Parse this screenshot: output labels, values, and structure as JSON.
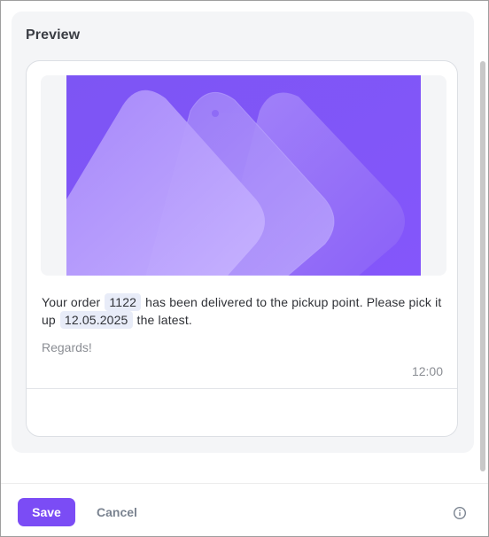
{
  "preview": {
    "title": "Preview"
  },
  "message": {
    "text_part1": "Your order",
    "var_order": "1122",
    "text_part2": "has been delivered to the pickup point. Please pick it up",
    "var_date": "12.05.2025",
    "text_part3": "the latest.",
    "regards": "Regards!",
    "time": "12:00"
  },
  "footer": {
    "save_label": "Save",
    "cancel_label": "Cancel"
  },
  "icons": {
    "info": "info-icon"
  },
  "colors": {
    "accent": "#7b4cf5",
    "image_bg": "#8a5cff"
  }
}
